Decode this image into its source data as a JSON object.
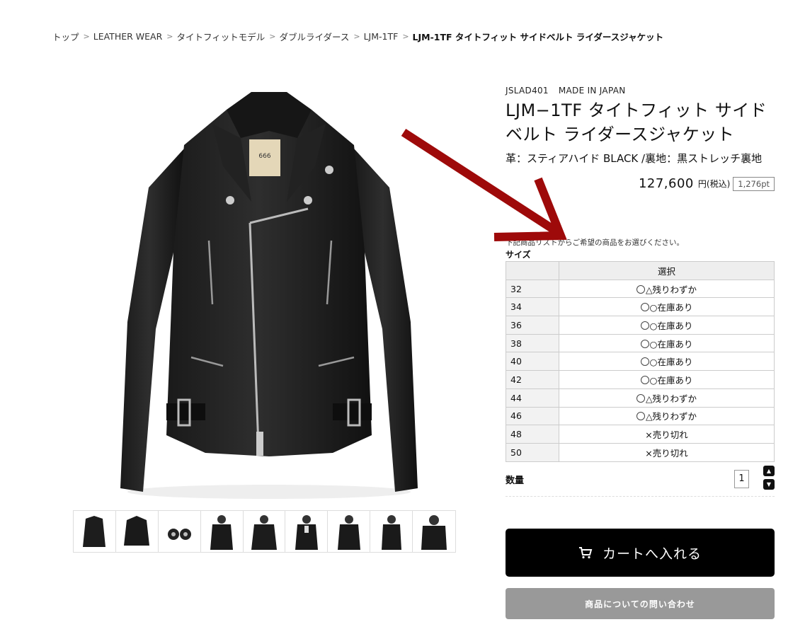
{
  "breadcrumb": {
    "items": [
      "トップ",
      "LEATHER WEAR",
      "タイトフィットモデル",
      "ダブルライダース",
      "LJM-1TF"
    ],
    "current": "LJM-1TF タイトフィット サイドベルト ライダースジャケット",
    "separator": ">"
  },
  "product": {
    "code": "JSLAD401",
    "origin": "MADE IN JAPAN",
    "title": "LJM−1TF タイトフィット サイドベルト ライダースジャケット",
    "material": "革：スティアハイド BLACK /裏地：黒ストレッチ裏地",
    "price": "127,600",
    "tax_label": "円(税込)",
    "points": "1,276pt"
  },
  "selection": {
    "notice": "下記商品リストからご希望の商品をお選びください。",
    "size_label": "サイズ",
    "column_header": "選択",
    "rows": [
      {
        "size": "32",
        "status": "△残りわずか",
        "selectable": true
      },
      {
        "size": "34",
        "status": "○在庫あり",
        "selectable": true
      },
      {
        "size": "36",
        "status": "○在庫あり",
        "selectable": true
      },
      {
        "size": "38",
        "status": "○在庫あり",
        "selectable": true
      },
      {
        "size": "40",
        "status": "○在庫あり",
        "selectable": true
      },
      {
        "size": "42",
        "status": "○在庫あり",
        "selectable": true
      },
      {
        "size": "44",
        "status": "△残りわずか",
        "selectable": true
      },
      {
        "size": "46",
        "status": "△残りわずか",
        "selectable": true
      },
      {
        "size": "48",
        "status": "×売り切れ",
        "selectable": false
      },
      {
        "size": "50",
        "status": "×売り切れ",
        "selectable": false
      }
    ]
  },
  "quantity": {
    "label": "数量",
    "value": "1"
  },
  "buttons": {
    "cart": "カートへ入れる",
    "inquiry": "商品についての問い合わせ"
  },
  "images": {
    "main": "black leather double rider jacket",
    "thumbnail_count": 9
  },
  "colors": {
    "arrow": "#9e0a0a",
    "cart_button": "#000000",
    "inquiry_button": "#999999"
  }
}
